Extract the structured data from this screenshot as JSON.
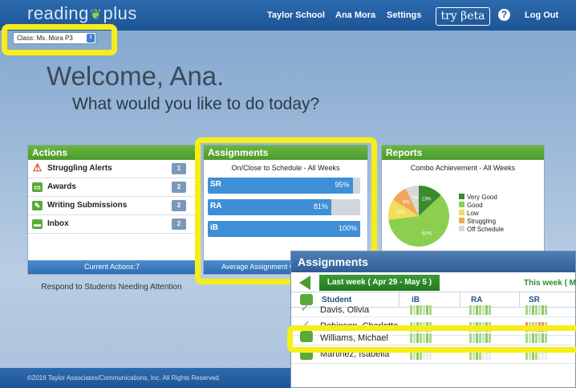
{
  "header": {
    "logo_text": "reading",
    "logo_text2": "plus",
    "nav": [
      "Taylor School",
      "Ana Mora",
      "Settings"
    ],
    "beta_label": "try βeta",
    "help_label": "?",
    "logout_label": "Log Out"
  },
  "class_select": {
    "value": "Class: Ms. Mora P3"
  },
  "welcome": {
    "title": "Welcome, Ana.",
    "subtitle": "What would you like to do today?"
  },
  "actions": {
    "title": "Actions",
    "items": [
      {
        "label": "Struggling Alerts",
        "count": "1",
        "icon": "warning-icon"
      },
      {
        "label": "Awards",
        "count": "2",
        "icon": "award-icon"
      },
      {
        "label": "Writing Submissions",
        "count": "2",
        "icon": "pencil-icon"
      },
      {
        "label": "Inbox",
        "count": "2",
        "icon": "chat-icon"
      }
    ],
    "footer": "Current Actions:7",
    "respond": "Respond to Students Needing Attention"
  },
  "assignments": {
    "title": "Assignments",
    "subtitle": "On/Close to Schedule - All Weeks",
    "bars": [
      {
        "badge": "SR",
        "pct_label": "95%",
        "pct": 95
      },
      {
        "badge": "RA",
        "pct_label": "81%",
        "pct": 81
      },
      {
        "badge": "iB",
        "pct_label": "100%",
        "pct": 100
      }
    ],
    "footer": "Average Assignment C"
  },
  "reports": {
    "title": "Reports",
    "subtitle": "Combo Achievement - All Weeks",
    "slices": [
      {
        "label": "Very Good",
        "value": 13,
        "color": "#3a8a2e"
      },
      {
        "label": "Good",
        "value": 60,
        "color": "#8ccf4e"
      },
      {
        "label": "Low",
        "value": 11,
        "color": "#f0dd5a"
      },
      {
        "label": "Struggling",
        "value": 9,
        "color": "#f2a65a"
      },
      {
        "label": "Off Schedule",
        "value": 7,
        "color": "#d8d8d8"
      }
    ],
    "slice_labels": [
      "13%",
      "60%",
      "11%",
      "9%",
      "7%"
    ]
  },
  "overlay": {
    "title": "Assignments",
    "last_week": "Last week ( Apr 29 - May 5 )",
    "this_week": "This week ( M",
    "columns": [
      "Student",
      "iB",
      "RA",
      "SR"
    ],
    "students": [
      {
        "name": "Davis, Olivia",
        "icon": "check-icon"
      },
      {
        "name": "Robinson, Charlotte",
        "icon": "check-icon"
      },
      {
        "name": "Williams, Michael",
        "icon": "chat-icon"
      },
      {
        "name": "Martinez, Isabella",
        "icon": "chat-icon"
      }
    ]
  },
  "footer": {
    "text": "©2016 Taylor Associates/Communications, Inc. All Rights Reserved."
  },
  "colors": {
    "brand_blue": "#1d5596",
    "accent_green": "#4a9a2c",
    "highlight": "#f7ee17"
  }
}
